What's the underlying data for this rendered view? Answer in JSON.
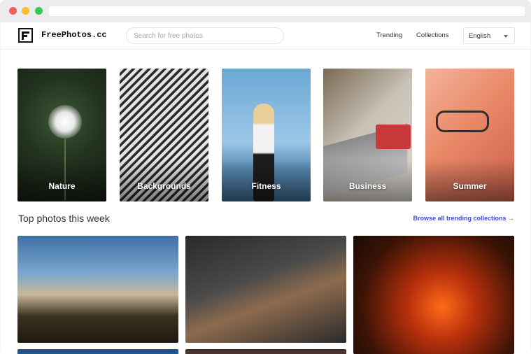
{
  "header": {
    "brand": "FreePhotos.cc",
    "search_placeholder": "Search for free photos",
    "nav": {
      "trending": "Trending",
      "collections": "Collections"
    },
    "language": "English"
  },
  "categories": [
    {
      "label": "Nature"
    },
    {
      "label": "Backgrounds"
    },
    {
      "label": "Fitness"
    },
    {
      "label": "Business"
    },
    {
      "label": "Summer"
    }
  ],
  "section": {
    "title": "Top photos this week",
    "browse_link": "Browse all trending collections →"
  },
  "colors": {
    "accent": "#3b4bd8",
    "close_dot": "#f25f58",
    "minimize_dot": "#fbbd2e",
    "maximize_dot": "#35c94a"
  }
}
